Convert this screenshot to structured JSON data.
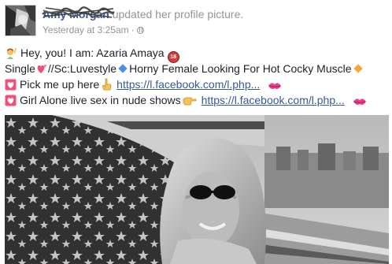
{
  "post": {
    "author": "Amy Morgan",
    "action": "updated her profile picture.",
    "timestamp": "Yesterday at 3:25am",
    "separator": "·",
    "privacy_icon": "globe-icon"
  },
  "text_lines": {
    "line1": {
      "emoji": "man-raising-hand",
      "text": "Hey, you! I am: Azaria Amaya",
      "badge": "18"
    },
    "line2": {
      "prefix": "Single",
      "emoji_heart": "two-hearts",
      "middle": "//Sc:Luvestyle",
      "blue_diamond": "small-blue-diamond",
      "main": "Horny Female Looking For Hot Cocky Muscle",
      "orange_diamond": "small-orange-diamond"
    },
    "line3": {
      "emoji": "heart-box",
      "text": "Pick me up here",
      "hand_emoji": "pointing-hand",
      "link": "https://l.facebook.com/l.php...",
      "lips_emoji": "kiss-mark"
    },
    "line4": {
      "emoji": "heart-box",
      "text": "Girl Alone live sex in nude shows",
      "hand_emoji": "pointing-right-hand",
      "link": "https://l.facebook.com/l.php...",
      "lips_emoji": "kiss-mark"
    }
  },
  "photo": {
    "subject": "profile-photo"
  },
  "colors": {
    "link": "#365899",
    "meta": "#90949c",
    "text": "#1d2129",
    "heart": "#f0507a"
  }
}
